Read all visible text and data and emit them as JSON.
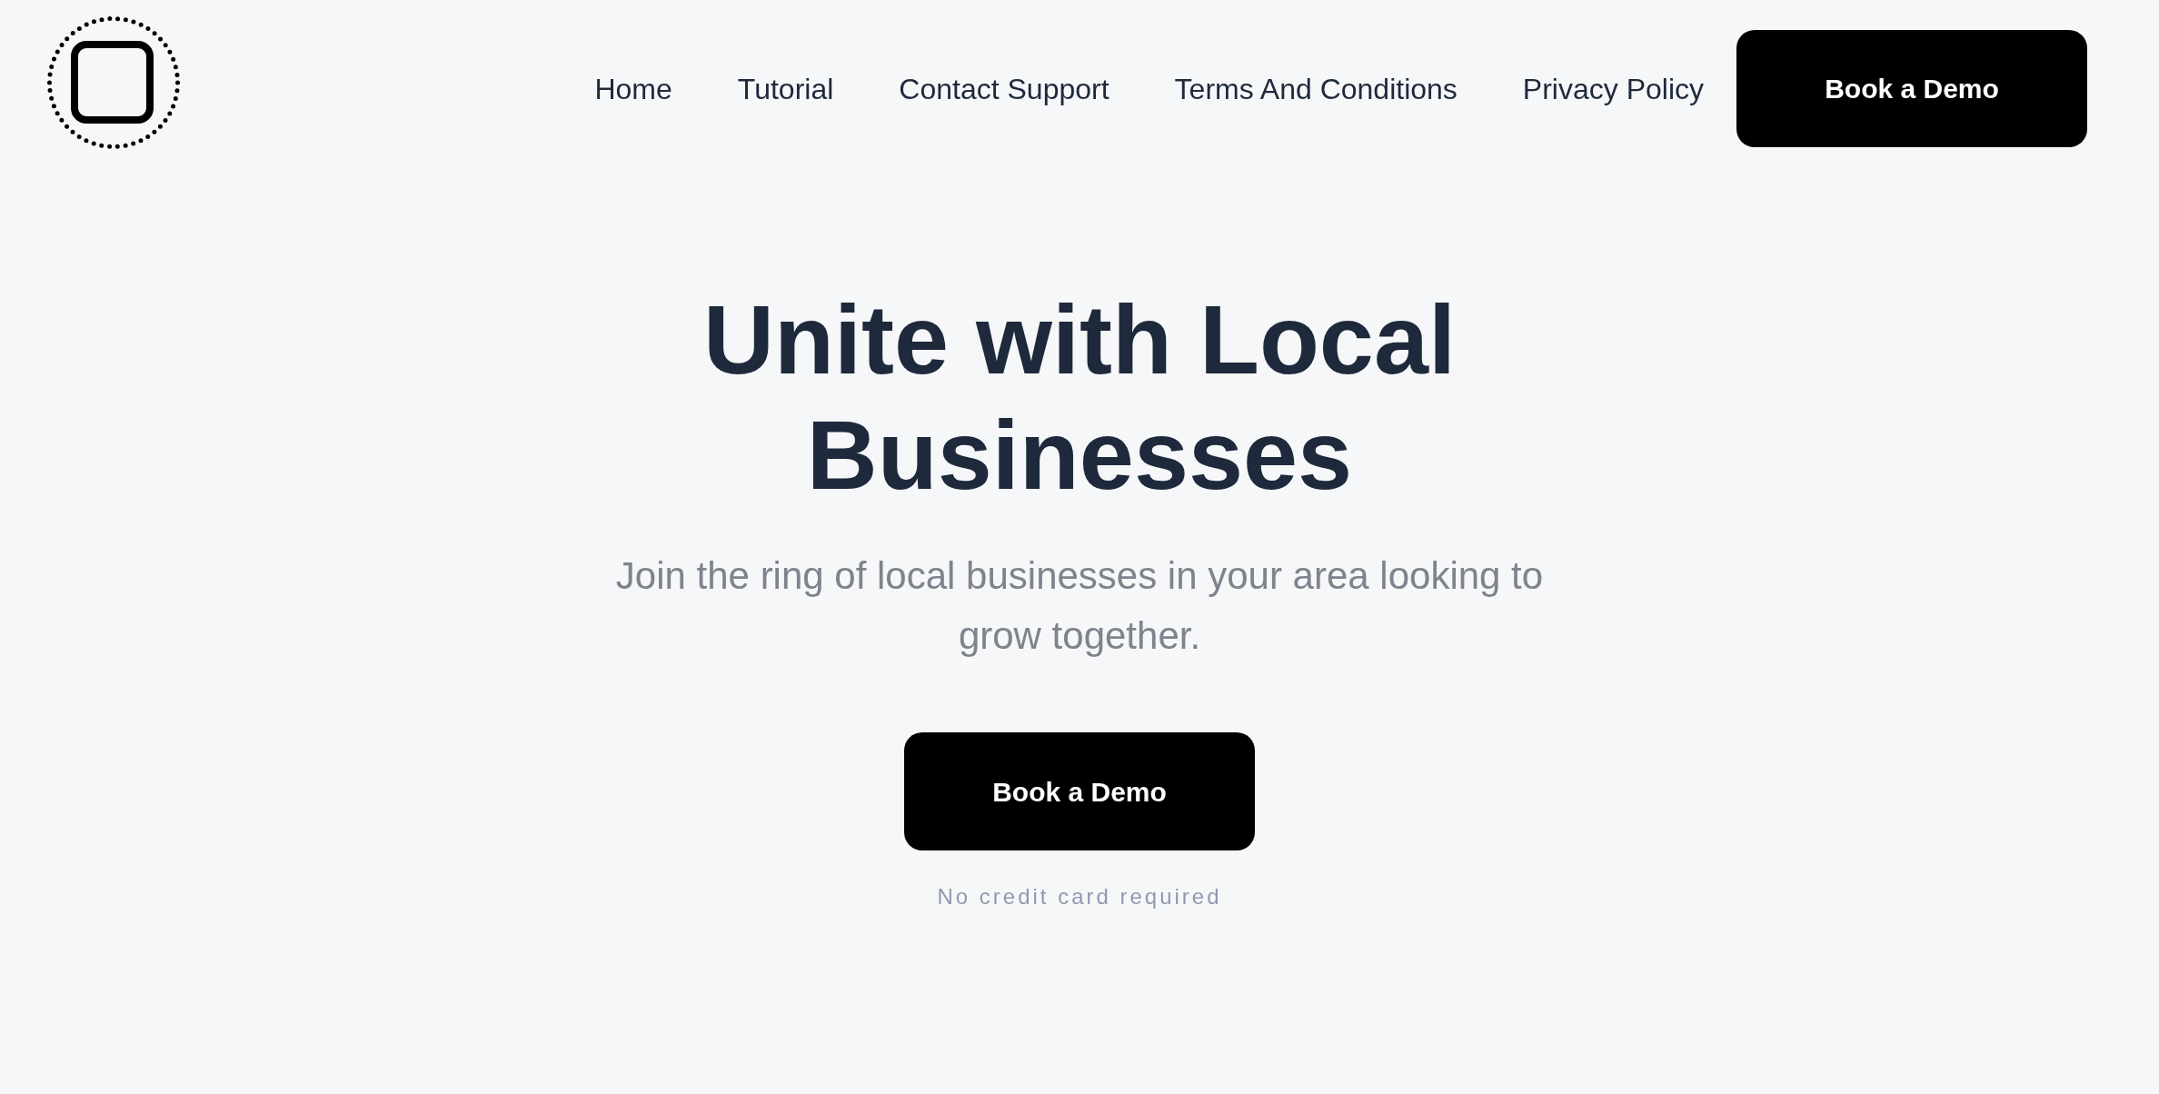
{
  "header": {
    "nav_links": [
      "Home",
      "Tutorial",
      "Contact Support",
      "Terms And Conditions",
      "Privacy Policy"
    ],
    "cta_button": "Book a Demo"
  },
  "hero": {
    "heading": "Unite with Local Businesses",
    "subheading": "Join the ring of local businesses in your area looking to grow together.",
    "cta_button": "Book a Demo",
    "note": "No credit card required"
  }
}
